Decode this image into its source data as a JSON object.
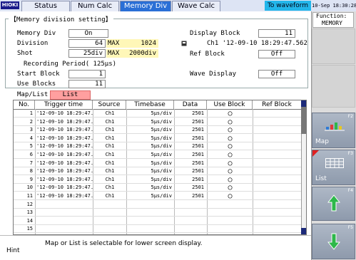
{
  "brand": "HIOKI",
  "tabs": [
    {
      "label": "Status",
      "active": false
    },
    {
      "label": "Num Calc",
      "active": false
    },
    {
      "label": "Memory Div",
      "active": true
    },
    {
      "label": "Wave Calc",
      "active": false
    }
  ],
  "to_waveform": "To waveform",
  "datetime": "10-Sep 18:30:28",
  "function_label": "Function:",
  "function_value": "MEMORY",
  "settings": {
    "title": "【Memory division setting】",
    "memory_div": {
      "label": "Memory Div",
      "value": "On"
    },
    "division": {
      "label": "Division",
      "value": "64",
      "max_label": "MAX",
      "max_value": "1024"
    },
    "shot": {
      "label": "Shot",
      "value": "25div",
      "max_label": "MAX",
      "max_value": "2000div"
    },
    "recording_period": "Recording Period(   125μs)",
    "start_block": {
      "label": "Start Block",
      "value": "1"
    },
    "use_blocks": {
      "label": "Use Blocks",
      "value": "11"
    },
    "display_block": {
      "label": "Display Block",
      "value": "11"
    },
    "trigger_info": "Ch1 '12-09-10 18:29:47.562",
    "ref_block": {
      "label": "Ref Block",
      "value": "Off"
    },
    "wave_display": {
      "label": "Wave Display",
      "value": "Off"
    }
  },
  "maplist": {
    "label": "Map/List",
    "value": "List"
  },
  "table": {
    "headers": [
      "No.",
      "Trigger time",
      "Source",
      "Timebase",
      "Data",
      "Use Block",
      "Ref Block"
    ],
    "rows": [
      {
        "no": "1",
        "time": "'12-09-10 18:29:47.398",
        "source": "Ch1",
        "timebase": "5μs/div",
        "data": "2501",
        "use": "○",
        "ref": ""
      },
      {
        "no": "2",
        "time": "'12-09-10 18:29:47.421",
        "source": "Ch1",
        "timebase": "5μs/div",
        "data": "2501",
        "use": "○",
        "ref": ""
      },
      {
        "no": "3",
        "time": "'12-09-10 18:29:47.445",
        "source": "Ch1",
        "timebase": "5μs/div",
        "data": "2501",
        "use": "○",
        "ref": ""
      },
      {
        "no": "4",
        "time": "'12-09-10 18:29:47.460",
        "source": "Ch1",
        "timebase": "5μs/div",
        "data": "2501",
        "use": "○",
        "ref": ""
      },
      {
        "no": "5",
        "time": "'12-09-10 18:29:47.476",
        "source": "Ch1",
        "timebase": "5μs/div",
        "data": "2501",
        "use": "○",
        "ref": ""
      },
      {
        "no": "6",
        "time": "'12-09-10 18:29:47.492",
        "source": "Ch1",
        "timebase": "5μs/div",
        "data": "2501",
        "use": "○",
        "ref": ""
      },
      {
        "no": "7",
        "time": "'12-09-10 18:29:47.507",
        "source": "Ch1",
        "timebase": "5μs/div",
        "data": "2501",
        "use": "○",
        "ref": ""
      },
      {
        "no": "8",
        "time": "'12-09-10 18:29:47.523",
        "source": "Ch1",
        "timebase": "5μs/div",
        "data": "2501",
        "use": "○",
        "ref": ""
      },
      {
        "no": "9",
        "time": "'12-09-10 18:29:47.531",
        "source": "Ch1",
        "timebase": "5μs/div",
        "data": "2501",
        "use": "○",
        "ref": ""
      },
      {
        "no": "10",
        "time": "'12-09-10 18:29:47.546",
        "source": "Ch1",
        "timebase": "5μs/div",
        "data": "2501",
        "use": "○",
        "ref": ""
      },
      {
        "no": "11",
        "time": "'12-09-10 18:29:47.562",
        "source": "Ch1",
        "timebase": "5μs/div",
        "data": "2501",
        "use": "○",
        "ref": ""
      },
      {
        "no": "12",
        "time": "",
        "source": "",
        "timebase": "",
        "data": "",
        "use": "",
        "ref": ""
      },
      {
        "no": "13",
        "time": "",
        "source": "",
        "timebase": "",
        "data": "",
        "use": "",
        "ref": ""
      },
      {
        "no": "14",
        "time": "",
        "source": "",
        "timebase": "",
        "data": "",
        "use": "",
        "ref": ""
      },
      {
        "no": "15",
        "time": "",
        "source": "",
        "timebase": "",
        "data": "",
        "use": "",
        "ref": ""
      }
    ]
  },
  "fkeys": {
    "f2": {
      "num": "F2",
      "label": "Map"
    },
    "f3": {
      "num": "F3",
      "label": "List"
    },
    "f4": {
      "num": "F4",
      "icon": "arrow-up-icon"
    },
    "f5": {
      "num": "F5",
      "icon": "arrow-down-icon"
    }
  },
  "hint": {
    "label": "Hint",
    "text": "Map or List is selectable for lower screen display."
  },
  "colors": {
    "active_tab": "#2a6fd6",
    "to_waveform": "#23b6ea",
    "list_button": "#ff9f9f",
    "max_highlight": "#fff7b8",
    "arrow_green": "#2db84a"
  }
}
